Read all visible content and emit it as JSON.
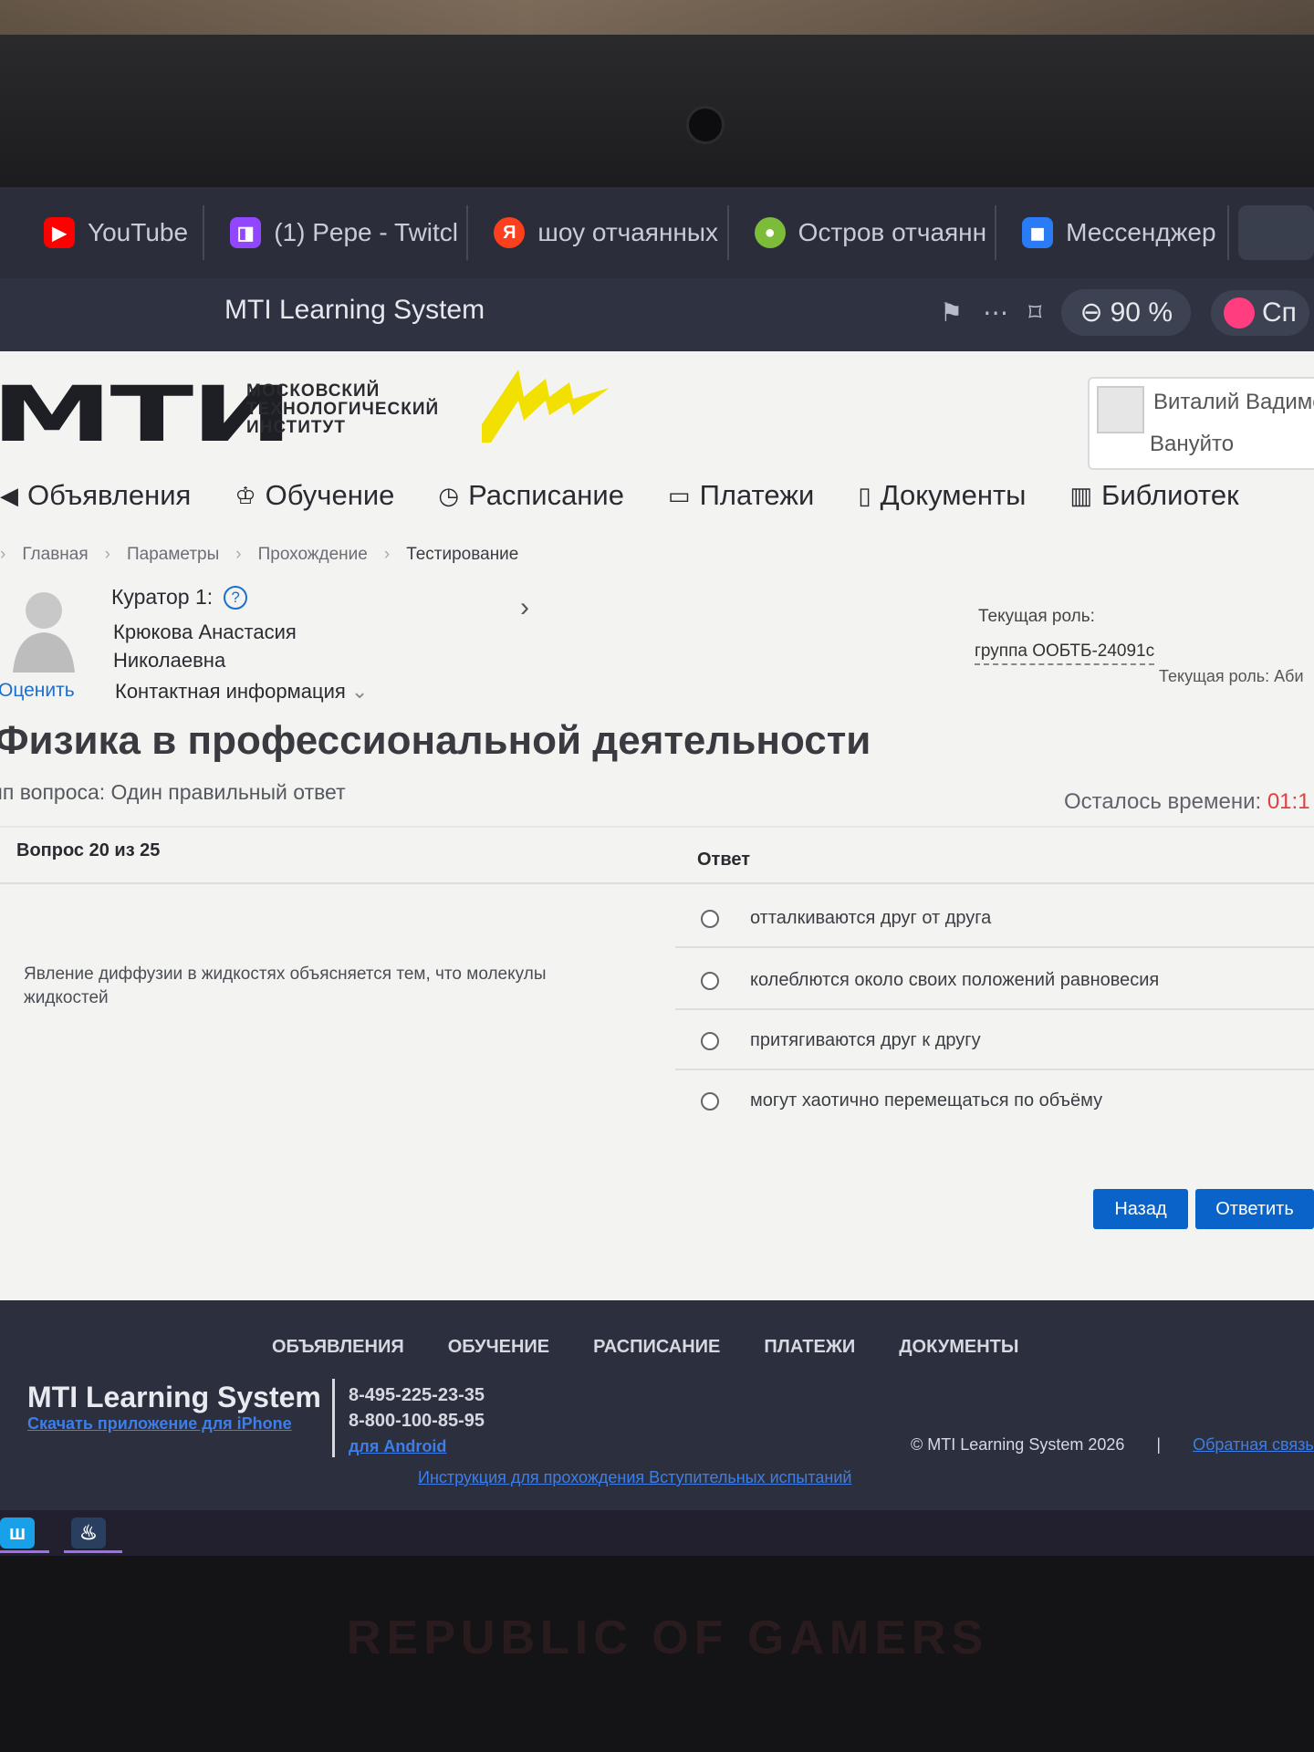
{
  "browser": {
    "tabs": [
      {
        "label": "YouTube",
        "icon": "youtube-icon",
        "color": "#ff0000",
        "glyph": "▶"
      },
      {
        "label": "(1) Pepe - Twitcl",
        "icon": "twitch-icon",
        "color": "#9146ff",
        "glyph": "◨"
      },
      {
        "label": "шоу отчаянных",
        "icon": "yandex-icon",
        "color": "#fc3f1d",
        "glyph": "Я"
      },
      {
        "label": "Остров отчаянн",
        "icon": "island-icon",
        "color": "#7dbb3a",
        "glyph": "●"
      },
      {
        "label": "Мессенджер",
        "icon": "messenger-icon",
        "color": "#2a7cf6",
        "glyph": "◼"
      }
    ],
    "page_title": "MTI Learning System",
    "zoom": "90 %",
    "profile_label": "Сп"
  },
  "header": {
    "logo_main": "МТИ",
    "logo_sub": [
      "МОСКОВСКИЙ",
      "ТЕХНОЛОГИЧЕСКИЙ",
      "ИНСТИТУТ"
    ],
    "user_name": "Виталий Вадимо",
    "user_surname": "Вануйто"
  },
  "nav": [
    {
      "label": "Объявления",
      "icon": "megaphone-icon",
      "glyph": "◀"
    },
    {
      "label": "Обучение",
      "icon": "graduation-cap-icon",
      "glyph": "♔"
    },
    {
      "label": "Расписание",
      "icon": "clock-icon",
      "glyph": "◷"
    },
    {
      "label": "Платежи",
      "icon": "payment-icon",
      "glyph": "▭"
    },
    {
      "label": "Документы",
      "icon": "document-icon",
      "glyph": "▯"
    },
    {
      "label": "Библиотек",
      "icon": "book-icon",
      "glyph": "▥"
    }
  ],
  "breadcrumb": [
    "Главная",
    "Параметры",
    "Прохождение",
    "Тестирование"
  ],
  "curator": {
    "title": "Куратор 1:",
    "name_line1": "Крюкова Анастасия",
    "name_line2": "Николаевна",
    "contact": "Контактная информация",
    "rate": "Оценить"
  },
  "role": {
    "label": "Текущая роль:",
    "group": "группа ООБТБ-24091с",
    "label2": "Текущая роль: Аби"
  },
  "test": {
    "course": "Физика в профессиональной деятельности",
    "question_type": "ип вопроса: Один правильный ответ",
    "time_label": "Осталось времени:",
    "time_value": "01:1",
    "progress": "Вопрос 20 из 25",
    "answer_header": "Ответ",
    "question": "Явление диффузии в жидкостях объясняется тем, что молекулы жидкостей",
    "answers": [
      "отталкиваются друг от друга",
      "колеблются около своих положений равновесия",
      "притягиваются друг к другу",
      "могут хаотично перемещаться по объёму"
    ],
    "back_button": "Назад",
    "submit_button": "Ответить"
  },
  "footer": {
    "nav": [
      "ОБЪЯВЛЕНИЯ",
      "ОБУЧЕНИЕ",
      "РАСПИСАНИЕ",
      "ПЛАТЕЖИ",
      "ДОКУМЕНТЫ"
    ],
    "brand": "MTI Learning System",
    "iphone_link": "Скачать приложение для iPhone",
    "phone1": "8-495-225-23-35",
    "phone2": "8-800-100-85-95",
    "android_link": "для Android",
    "copyright": "© MTI Learning System 2026",
    "feedback": "Обратная связь",
    "instructions": "Инструкция для прохождения Вступительных испытаний"
  },
  "taskbar": [
    {
      "icon": "app-w-icon",
      "glyph": "ш",
      "color": "#18a0e8"
    },
    {
      "icon": "steam-icon",
      "glyph": "♨",
      "color": "#2a3f60"
    }
  ],
  "device": {
    "brand": "REPUBLIC OF GAMERS"
  },
  "colors": {
    "accent": "#0a63c8",
    "timer": "#e04040",
    "logo_mark": "#f2e000"
  }
}
